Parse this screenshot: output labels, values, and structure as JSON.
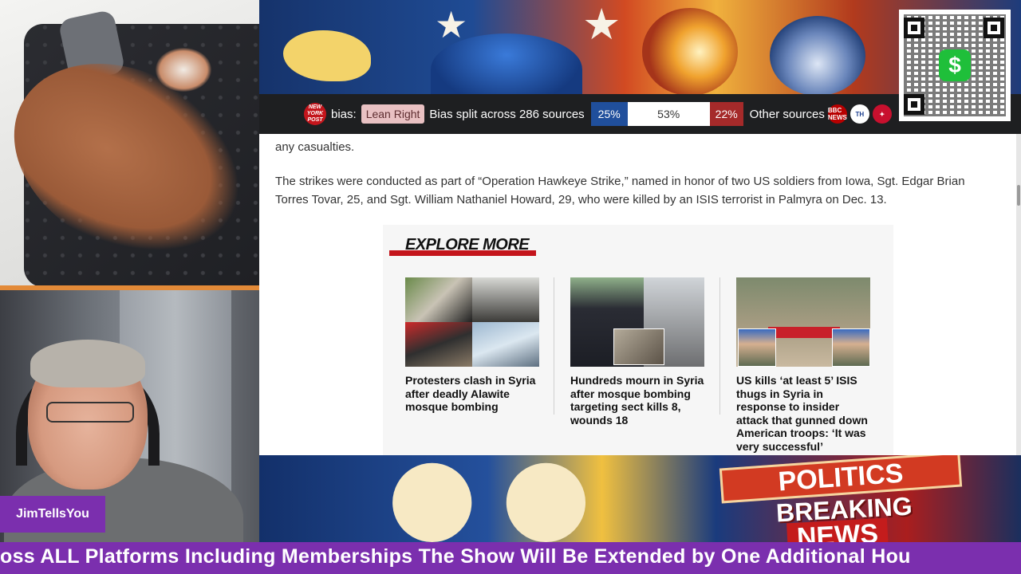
{
  "streamer": {
    "name": "JimTellsYou"
  },
  "bias_bar": {
    "source_logo_text": "NEW YORK POST",
    "bias_label": "bias:",
    "bias_value": "Lean Right",
    "split_label": "Bias split across 286 sources",
    "left_pct": "25%",
    "center_pct": "53%",
    "right_pct": "22%",
    "other_label": "Other sources",
    "colors": {
      "left": "#204f9c",
      "center": "#ffffff",
      "right": "#a52a2a",
      "lean_badge": "#e9c1c3"
    },
    "source_icons": [
      {
        "name": "bbc-news-icon",
        "text": "BBC NEWS",
        "bg": "#b80000",
        "fg": "#ffffff"
      },
      {
        "name": "the-hindu-icon",
        "text": "TH",
        "bg": "#ffffff",
        "fg": "#1d3f8f"
      },
      {
        "name": "eagle-icon",
        "text": "",
        "bg": "#c8102e",
        "fg": "#ffffff"
      }
    ]
  },
  "qr": {
    "cash_symbol": "$"
  },
  "article": {
    "para_1": "any casualties.",
    "para_2": "The strikes were conducted as part of “Operation Hawkeye Strike,” named in honor of two US soldiers from Iowa, Sgt. Edgar Brian Torres Tovar, 25, and Sgt. William Nathaniel Howard, 29, who were killed by an ISIS terrorist in Palmyra on Dec. 13."
  },
  "explore_more": {
    "heading": "EXPLORE MORE",
    "cards": [
      {
        "title": "Protesters clash in Syria after deadly Alawite mosque bombing"
      },
      {
        "title": "Hundreds mourn in Syria after mosque bombing targeting sect kills 8, wounds 18"
      },
      {
        "title": "US kills ‘at least 5’ ISIS thugs in Syria in response to insider attack that gunned down American troops: ‘It was very successful’"
      }
    ]
  },
  "bottom_banner": {
    "politics": "POLITICS",
    "breaking": "BREAKING",
    "news": "NEWS"
  },
  "ticker": {
    "text": "ross ALL Platforms Including Memberships The Show Will Be Extended by One Additional Hou"
  }
}
